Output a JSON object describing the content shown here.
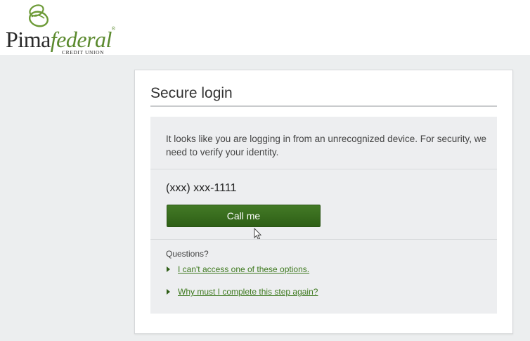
{
  "header": {
    "logo": {
      "word_plain": "Pima",
      "word_italic": "federal",
      "registered": "®",
      "subtitle": "CREDIT UNION"
    }
  },
  "login": {
    "title": "Secure login",
    "message": "It looks like you are logging in from an unrecognized device. For security, we need to verify your identity.",
    "phone": "(xxx) xxx-1111",
    "call_button": "Call me",
    "questions_label": "Questions?",
    "links": [
      "I can't access one of these options.",
      "Why must I complete this step again?"
    ]
  },
  "colors": {
    "brand_green": "#2e5f16",
    "link_green": "#3f7a20",
    "panel_gray": "#edeef0",
    "page_band": "#eceeef"
  }
}
